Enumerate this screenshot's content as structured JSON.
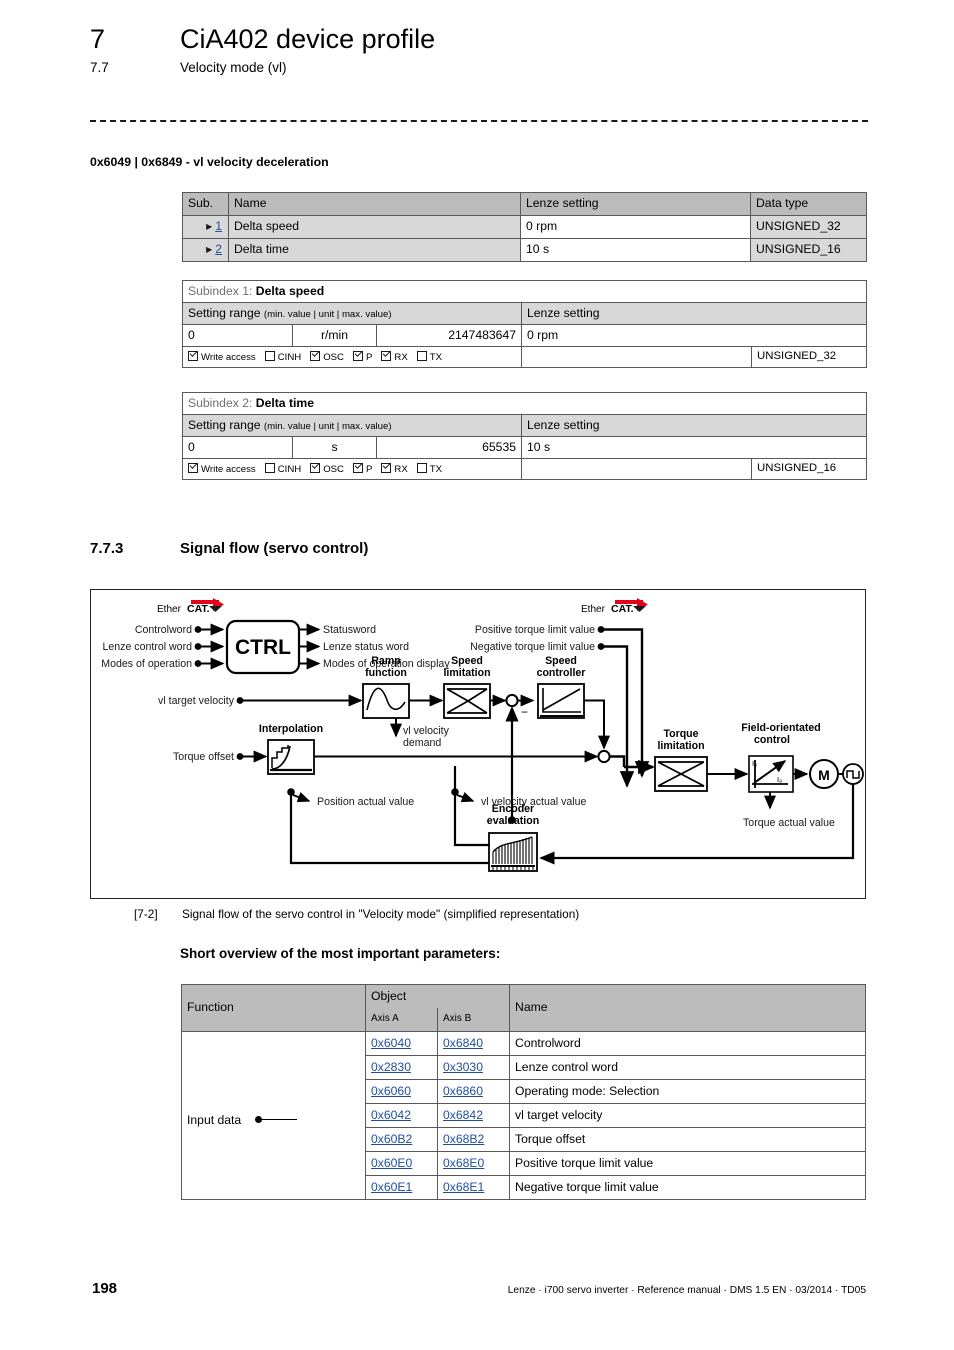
{
  "header": {
    "chapter_number": "7",
    "chapter_title": "CiA402 device profile",
    "section_number": "7.7",
    "section_title": "Velocity mode (vl)"
  },
  "object_heading": "0x6049 | 0x6849 - vl velocity deceleration",
  "subindex_table": {
    "columns": [
      "Sub.",
      "Name",
      "Lenze setting",
      "Data type"
    ],
    "rows": [
      {
        "sub": "1",
        "name": "Delta speed",
        "lenze_setting": "0 rpm",
        "data_type": "UNSIGNED_32"
      },
      {
        "sub": "2",
        "name": "Delta time",
        "lenze_setting": "10 s",
        "data_type": "UNSIGNED_16"
      }
    ]
  },
  "detail_tables": [
    {
      "title_prefix": "Subindex 1:",
      "title_name": "Delta speed",
      "range_label": "Setting range",
      "range_hint": "(min. value | unit | max. value)",
      "lenze_setting_label": "Lenze setting",
      "min_value": "0",
      "unit": "r/min",
      "max_value": "2147483647",
      "lenze_setting": "0 rpm",
      "data_type": "UNSIGNED_32",
      "flags": [
        {
          "label": "Write access",
          "checked": true
        },
        {
          "label": "CINH",
          "checked": false
        },
        {
          "label": "OSC",
          "checked": true
        },
        {
          "label": "P",
          "checked": true
        },
        {
          "label": "RX",
          "checked": true
        },
        {
          "label": "TX",
          "checked": false
        }
      ]
    },
    {
      "title_prefix": "Subindex 2:",
      "title_name": "Delta time",
      "range_label": "Setting range",
      "range_hint": "(min. value | unit | max. value)",
      "lenze_setting_label": "Lenze setting",
      "min_value": "0",
      "unit": "s",
      "max_value": "65535",
      "lenze_setting": "10 s",
      "data_type": "UNSIGNED_16",
      "flags": [
        {
          "label": "Write access",
          "checked": true
        },
        {
          "label": "CINH",
          "checked": false
        },
        {
          "label": "OSC",
          "checked": true
        },
        {
          "label": "P",
          "checked": true
        },
        {
          "label": "RX",
          "checked": true
        },
        {
          "label": "TX",
          "checked": false
        }
      ]
    }
  ],
  "section_773": {
    "number": "7.7.3",
    "title": "Signal flow (servo control)"
  },
  "figure": {
    "caption_number": "[7-2]",
    "caption_text": "Signal flow of the servo control in \"Velocity mode\" (simplified representation)",
    "logo_left": "EtherCAT.",
    "logo_right": "EtherCAT.",
    "ctrl_block": "CTRL",
    "inputs_left": [
      "Controlword",
      "Lenze control word",
      "Modes of operation"
    ],
    "outputs_right": [
      "Statusword",
      "Lenze status word",
      "Modes of operation display"
    ],
    "signal_vl_target": "vl target velocity",
    "signal_torque_offset": "Torque offset",
    "signal_pos_limit": "Positive torque limit value",
    "signal_neg_limit": "Negative torque limit value",
    "block_interpolation": "Interpolation",
    "block_ramp": "Ramp\nfunction",
    "block_ramp_l1": "Ramp",
    "block_ramp_l2": "function",
    "block_speed_limitation_l1": "Speed",
    "block_speed_limitation_l2": "limitation",
    "block_speed_controller_l1": "Speed",
    "block_speed_controller_l2": "controller",
    "block_torque_limitation_l1": "Torque",
    "block_torque_limitation_l2": "limitation",
    "block_foc_l1": "Field-orientated",
    "block_foc_l2": "control",
    "block_encoder_l1": "Encoder",
    "block_encoder_l2": "evaluation",
    "label_vl_velocity_demand_l1": "vl velocity",
    "label_vl_velocity_demand_l2": "demand",
    "label_position_actual": "Position actual value",
    "label_vl_velocity_actual": "vl velocity actual value",
    "label_torque_actual": "Torque actual value",
    "motor_symbol": "M",
    "foc_axis_q": "Iq",
    "foc_axis_d": "Id",
    "minus_sign": "−"
  },
  "short_overview_title": "Short overview of the most important parameters:",
  "params_table": {
    "columns": [
      "Function",
      "Object",
      "Name"
    ],
    "axis_a_label": "Axis A",
    "axis_b_label": "Axis B",
    "function_label": "Input data",
    "rows": [
      {
        "axis_a": "0x6040",
        "axis_b": "0x6840",
        "name": "Controlword"
      },
      {
        "axis_a": "0x2830",
        "axis_b": "0x3030",
        "name": "Lenze control word"
      },
      {
        "axis_a": "0x6060",
        "axis_b": "0x6860",
        "name": "Operating mode: Selection"
      },
      {
        "axis_a": "0x6042",
        "axis_b": "0x6842",
        "name": "vl target velocity"
      },
      {
        "axis_a": "0x60B2",
        "axis_b": "0x68B2",
        "name": "Torque offset"
      },
      {
        "axis_a": "0x60E0",
        "axis_b": "0x68E0",
        "name": "Positive torque limit value"
      },
      {
        "axis_a": "0x60E1",
        "axis_b": "0x68E1",
        "name": "Negative torque limit value"
      }
    ]
  },
  "footer": {
    "page_number": "198",
    "text": "Lenze · i700 servo inverter · Reference manual · DMS 1.5 EN · 03/2014 · TD05"
  },
  "colors": {
    "link": "#1f4e9c",
    "header_bg": "#bcbcbc",
    "row_bg": "#d8d8d8",
    "logo_red": "#e2001a"
  }
}
